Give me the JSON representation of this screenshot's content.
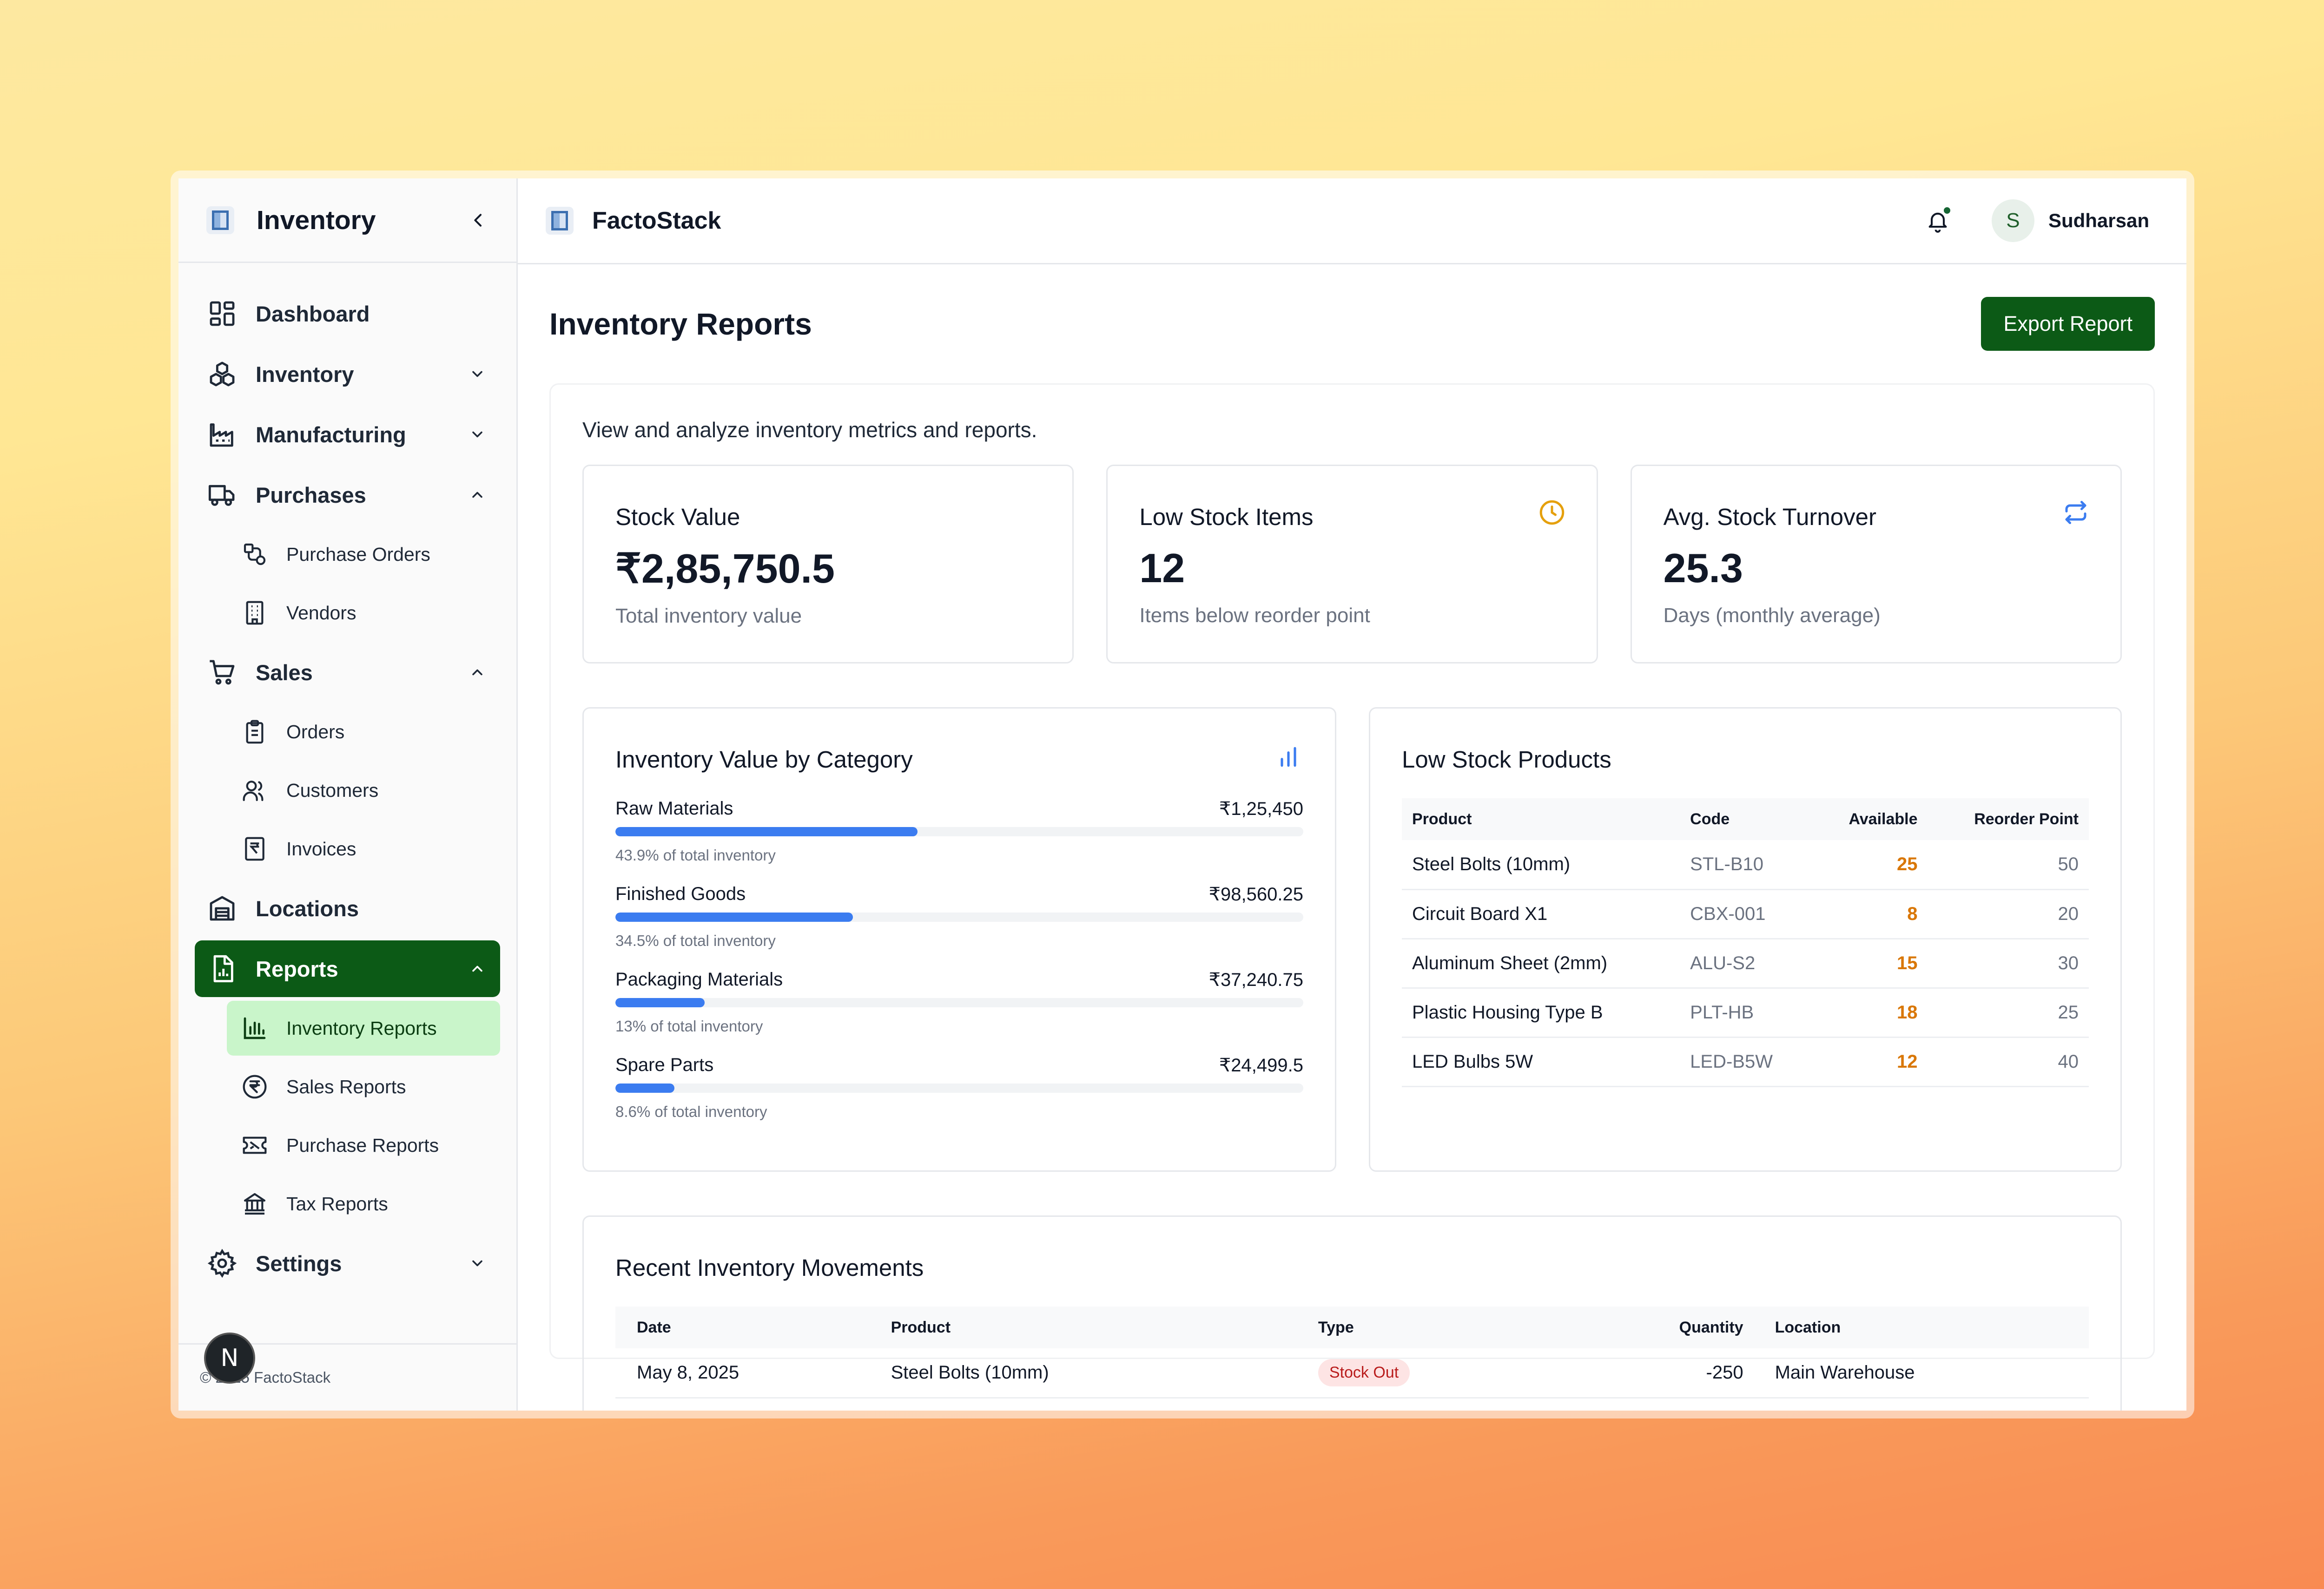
{
  "sidebar": {
    "title": "Inventory",
    "items": [
      {
        "label": "Dashboard"
      },
      {
        "label": "Inventory"
      },
      {
        "label": "Manufacturing"
      },
      {
        "label": "Purchases",
        "children": [
          {
            "label": "Purchase Orders"
          },
          {
            "label": "Vendors"
          }
        ]
      },
      {
        "label": "Sales",
        "children": [
          {
            "label": "Orders"
          },
          {
            "label": "Customers"
          },
          {
            "label": "Invoices"
          }
        ]
      },
      {
        "label": "Locations"
      },
      {
        "label": "Reports",
        "children": [
          {
            "label": "Inventory Reports"
          },
          {
            "label": "Sales Reports"
          },
          {
            "label": "Purchase Reports"
          },
          {
            "label": "Tax Reports"
          }
        ]
      },
      {
        "label": "Settings"
      }
    ],
    "footer": "© 2025 FactoStack",
    "badge": "N"
  },
  "topbar": {
    "brand": "FactoStack",
    "user_initial": "S",
    "user_name": "Sudharsan"
  },
  "page": {
    "title": "Inventory Reports",
    "export_label": "Export Report",
    "intro": "View and analyze inventory metrics and reports."
  },
  "stats": [
    {
      "label": "Stock Value",
      "value": "₹2,85,750.5",
      "sub": "Total inventory value"
    },
    {
      "label": "Low Stock Items",
      "value": "12",
      "sub": "Items below reorder point",
      "icon": "clock-icon",
      "icon_color": "#e5a00d"
    },
    {
      "label": "Avg. Stock Turnover",
      "value": "25.3",
      "sub": "Days (monthly average)",
      "icon": "refresh-icon",
      "icon_color": "#3b7cf0"
    }
  ],
  "category": {
    "title": "Inventory Value by Category",
    "items": [
      {
        "name": "Raw Materials",
        "amount": "₹1,25,450",
        "pct_label": "43.9% of total inventory",
        "fraction": 0.439
      },
      {
        "name": "Finished Goods",
        "amount": "₹98,560.25",
        "pct_label": "34.5% of total inventory",
        "fraction": 0.345
      },
      {
        "name": "Packaging Materials",
        "amount": "₹37,240.75",
        "pct_label": "13% of total inventory",
        "fraction": 0.13
      },
      {
        "name": "Spare Parts",
        "amount": "₹24,499.5",
        "pct_label": "8.6% of total inventory",
        "fraction": 0.086
      }
    ]
  },
  "low_stock": {
    "title": "Low Stock Products",
    "headers": [
      "Product",
      "Code",
      "Available",
      "Reorder Point"
    ],
    "rows": [
      {
        "product": "Steel Bolts (10mm)",
        "code": "STL-B10",
        "available": "25",
        "reorder": "50"
      },
      {
        "product": "Circuit Board X1",
        "code": "CBX-001",
        "available": "8",
        "reorder": "20"
      },
      {
        "product": "Aluminum Sheet (2mm)",
        "code": "ALU-S2",
        "available": "15",
        "reorder": "30"
      },
      {
        "product": "Plastic Housing Type B",
        "code": "PLT-HB",
        "available": "18",
        "reorder": "25"
      },
      {
        "product": "LED Bulbs 5W",
        "code": "LED-B5W",
        "available": "12",
        "reorder": "40"
      }
    ]
  },
  "movements": {
    "title": "Recent Inventory Movements",
    "headers": [
      "Date",
      "Product",
      "Type",
      "Quantity",
      "Location"
    ],
    "rows": [
      {
        "date": "May 8, 2025",
        "product": "Steel Bolts (10mm)",
        "type": "Stock Out",
        "quantity": "-250",
        "location": "Main Warehouse"
      }
    ]
  },
  "colors": {
    "accent": "#0c5a16",
    "active_sub_bg": "#c9f5ca",
    "bar": "#3b7cf0",
    "warn": "#d97706"
  }
}
